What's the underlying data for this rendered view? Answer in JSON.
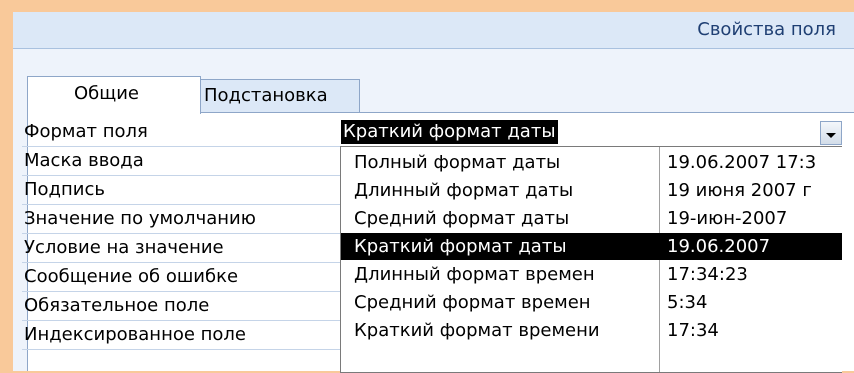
{
  "title": "Свойства поля",
  "tabs": [
    {
      "label": "Общие"
    },
    {
      "label": "Подстановка"
    }
  ],
  "properties": [
    {
      "label": "Формат поля"
    },
    {
      "label": "Маска ввода"
    },
    {
      "label": "Подпись"
    },
    {
      "label": "Значение по умолчанию"
    },
    {
      "label": "Условие на значение"
    },
    {
      "label": "Сообщение об ошибке"
    },
    {
      "label": "Обязательное поле"
    },
    {
      "label": "Индексированное поле"
    }
  ],
  "format_field": {
    "value": "Краткий формат даты"
  },
  "dropdown": {
    "options": [
      {
        "name": "Полный формат даты",
        "example": "19.06.2007 17:3"
      },
      {
        "name": "Длинный формат даты",
        "example": "19 июня 2007 г"
      },
      {
        "name": "Средний формат даты",
        "example": "19-июн-2007"
      },
      {
        "name": "Краткий формат даты",
        "example": "19.06.2007"
      },
      {
        "name": "Длинный формат времен",
        "example": "17:34:23"
      },
      {
        "name": "Средний формат времен",
        "example": "5:34"
      },
      {
        "name": "Краткий формат времени",
        "example": "17:34"
      }
    ],
    "selected_index": 3
  }
}
